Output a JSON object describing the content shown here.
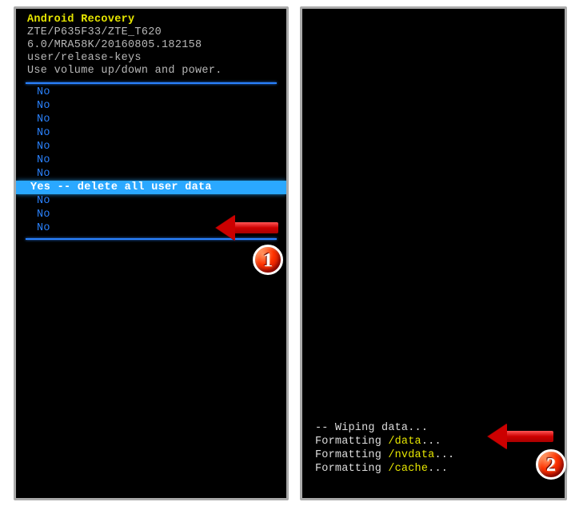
{
  "left": {
    "title": "Android Recovery",
    "line1": "ZTE/P635F33/ZTE_T620",
    "line2": "6.0/MRA58K/20160805.182158",
    "line3": "user/release-keys",
    "hint": "Use volume up/down and power.",
    "menu": [
      {
        "label": "No",
        "selected": false
      },
      {
        "label": "No",
        "selected": false
      },
      {
        "label": "No",
        "selected": false
      },
      {
        "label": "No",
        "selected": false
      },
      {
        "label": "No",
        "selected": false
      },
      {
        "label": "No",
        "selected": false
      },
      {
        "label": "No",
        "selected": false
      },
      {
        "label": "Yes -- delete all user data",
        "selected": true
      },
      {
        "label": "No",
        "selected": false
      },
      {
        "label": "No",
        "selected": false
      },
      {
        "label": "No",
        "selected": false
      }
    ]
  },
  "right": {
    "log": [
      {
        "pre": "-- ",
        "hl": "",
        "txt": "Wiping data..."
      },
      {
        "pre": "Formatting ",
        "hl": "/data",
        "txt": "..."
      },
      {
        "pre": "Formatting ",
        "hl": "/nvdata",
        "txt": "..."
      },
      {
        "pre": "Formatting ",
        "hl": "/cache",
        "txt": "..."
      }
    ]
  },
  "badges": {
    "b1": "1",
    "b2": "2"
  }
}
